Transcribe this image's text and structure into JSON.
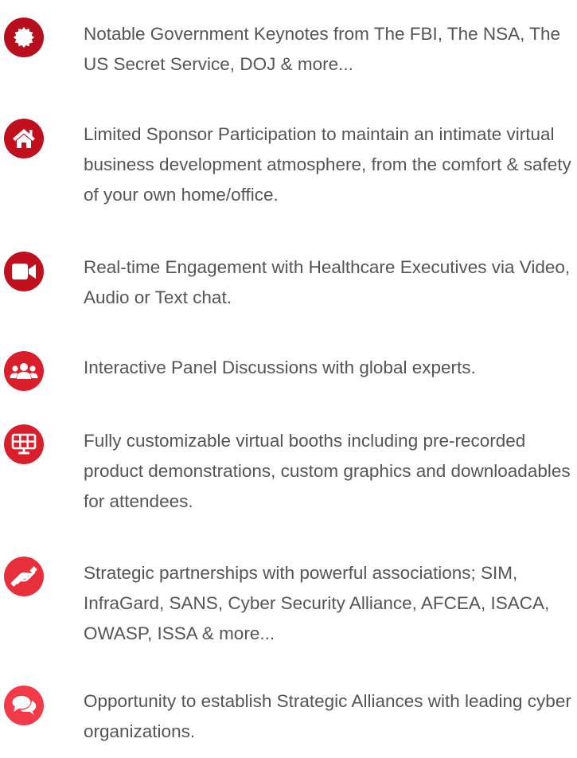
{
  "colors": {
    "icon_dark": "#b80f1e",
    "icon_bright": "#f23a48",
    "text": "#555559"
  },
  "features": [
    {
      "icon": "badge-seal-icon",
      "text": "Notable Government Keynotes from The FBI, The NSA, The US Secret Service, DOJ & more..."
    },
    {
      "icon": "home-icon",
      "text": "Limited Sponsor Participation to maintain an intimate virtual business development atmosphere, from the comfort & safety of your own home/office."
    },
    {
      "icon": "video-camera-icon",
      "text": "Real-time Engagement with Healthcare Executives via Video, Audio or Text chat."
    },
    {
      "icon": "users-group-icon",
      "text": "Interactive Panel Discussions with global experts."
    },
    {
      "icon": "booth-display-icon",
      "text": "Fully customizable virtual booths including pre-recorded product demonstrations, custom graphics and downloadables for attendees."
    },
    {
      "icon": "handshake-icon",
      "text": "Strategic partnerships with powerful associations; SIM, InfraGard, SANS, Cyber Security Alliance, AFCEA, ISACA, OWASP, ISSA & more..."
    },
    {
      "icon": "chat-bubbles-icon",
      "text": "Opportunity to establish Strategic Alliances with leading cyber organizations."
    }
  ]
}
